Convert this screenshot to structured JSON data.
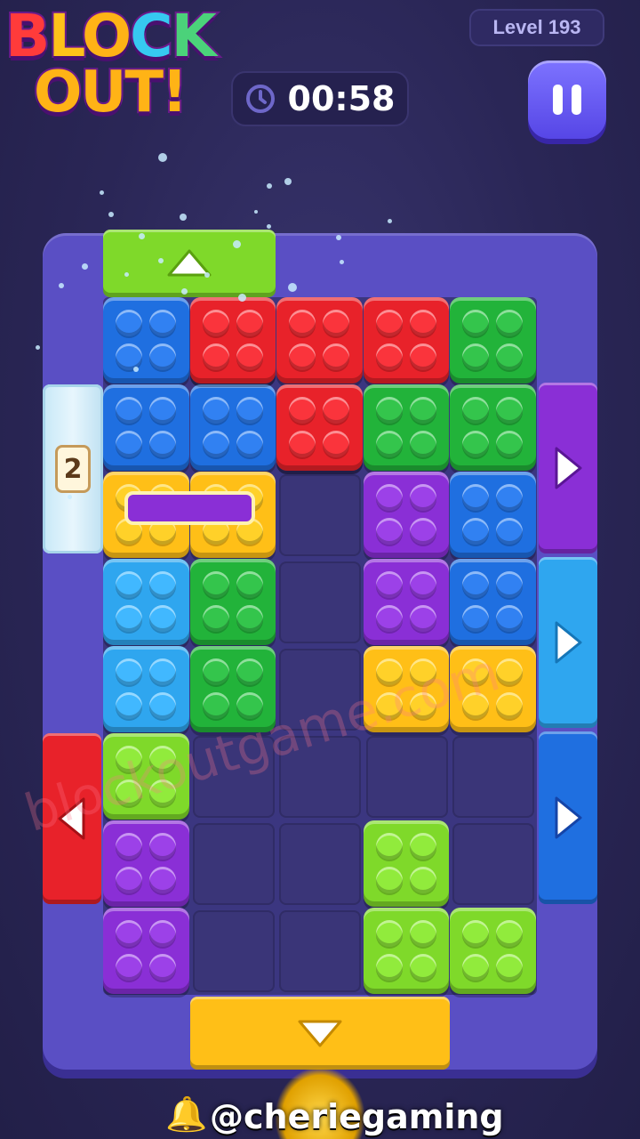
{
  "logo": {
    "line1": [
      "B",
      "L",
      "O",
      "C",
      "K"
    ],
    "line2": "OUT!"
  },
  "level": {
    "label": "Level 193"
  },
  "timer": {
    "value": "00:58",
    "icon": "clock-icon"
  },
  "pause": {
    "icon": "pause-icon"
  },
  "colors": {
    "red": "#e8222a",
    "blue": "#1f6fe0",
    "lightblue": "#2fa6ef",
    "green": "#22b33a",
    "lime": "#7fd92a",
    "yellow": "#ffbf17",
    "purple": "#8a2fd6",
    "board": "#5a4fc4",
    "cell": "#3a3578"
  },
  "board": {
    "cols": 5,
    "rows": 8
  },
  "pieces": [
    {
      "color": "blue",
      "cells": [
        [
          0,
          0
        ],
        [
          0,
          1
        ],
        [
          1,
          0
        ],
        [
          1,
          1
        ],
        [
          2,
          1
        ]
      ]
    },
    {
      "color": "red",
      "cells": [
        [
          1,
          0
        ],
        [
          2,
          0
        ],
        [
          3,
          0
        ],
        [
          2,
          1
        ]
      ]
    },
    {
      "color": "green",
      "cells": [
        [
          4,
          0
        ],
        [
          3,
          1
        ],
        [
          4,
          1
        ]
      ]
    },
    {
      "color": "yellow",
      "cells": [
        [
          0,
          2
        ],
        [
          1,
          2
        ]
      ],
      "locked": true
    },
    {
      "color": "purple",
      "cells": [
        [
          3,
          2
        ],
        [
          3,
          3
        ]
      ]
    },
    {
      "color": "blue",
      "cells": [
        [
          4,
          2
        ],
        [
          4,
          3
        ]
      ]
    },
    {
      "color": "lightblue",
      "cells": [
        [
          0,
          3
        ],
        [
          0,
          4
        ]
      ]
    },
    {
      "color": "green",
      "cells": [
        [
          1,
          3
        ],
        [
          1,
          4
        ]
      ]
    },
    {
      "color": "yellow",
      "cells": [
        [
          3,
          4
        ],
        [
          4,
          4
        ]
      ]
    },
    {
      "color": "lime",
      "cells": [
        [
          0,
          5
        ]
      ]
    },
    {
      "color": "purple",
      "cells": [
        [
          0,
          6
        ],
        [
          0,
          7
        ]
      ]
    },
    {
      "color": "lime",
      "cells": [
        [
          3,
          6
        ],
        [
          3,
          7
        ],
        [
          4,
          7
        ]
      ]
    }
  ],
  "gates": [
    {
      "name": "top-gate-lime",
      "color": "lime",
      "side": "top",
      "icon": "up-arrow-icon",
      "arrow": "▲"
    },
    {
      "name": "bottom-gate-yellow",
      "color": "yellow",
      "side": "bottom",
      "icon": "down-arrow-icon",
      "arrow": "▼"
    },
    {
      "name": "left-gate-red",
      "color": "red",
      "side": "left",
      "icon": "left-arrow-icon",
      "arrow": "◀"
    },
    {
      "name": "right-gate-purple",
      "color": "purple",
      "side": "right",
      "icon": "right-arrow-icon",
      "arrow": "▶"
    },
    {
      "name": "right-gate-lightblue",
      "color": "lightblue",
      "side": "right",
      "icon": "right-arrow-icon",
      "arrow": "▶"
    },
    {
      "name": "right-gate-blue",
      "color": "blue",
      "side": "right",
      "icon": "right-arrow-icon",
      "arrow": "▶"
    }
  ],
  "ice_gate": {
    "count": "2"
  },
  "watermark": "blockoutgame.com",
  "footer": {
    "handle": "@cheriegaming",
    "icon": "bell-icon"
  }
}
